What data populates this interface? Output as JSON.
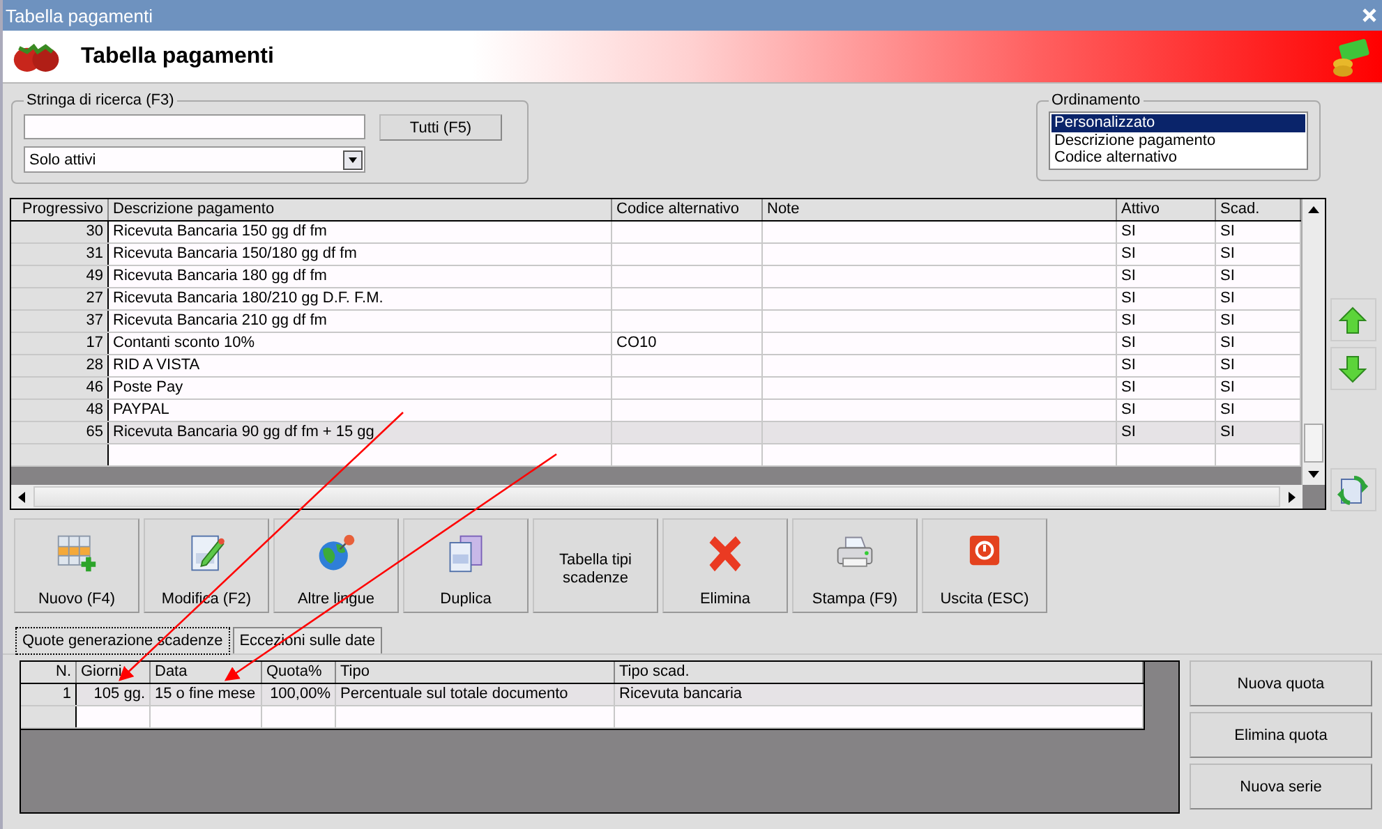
{
  "window": {
    "title": "Tabella pagamenti"
  },
  "header": {
    "title": "Tabella pagamenti"
  },
  "search": {
    "legend": "Stringa di ricerca (F3)",
    "button": "Tutti (F5)",
    "filter": "Solo attivi"
  },
  "ordering": {
    "legend": "Ordinamento",
    "items": [
      {
        "label": "Personalizzato",
        "selected": true
      },
      {
        "label": "Descrizione pagamento",
        "selected": false
      },
      {
        "label": "Codice alternativo",
        "selected": false
      }
    ]
  },
  "table": {
    "columns": [
      "Progressivo",
      "Descrizione pagamento",
      "Codice alternativo",
      "Note",
      "Attivo",
      "Scad."
    ],
    "rows": [
      {
        "cells": [
          "30",
          "Ricevuta Bancaria 150 gg df fm",
          "",
          "",
          "SI",
          "SI"
        ],
        "selected": false
      },
      {
        "cells": [
          "31",
          "Ricevuta Bancaria 150/180 gg df fm",
          "",
          "",
          "SI",
          "SI"
        ],
        "selected": false
      },
      {
        "cells": [
          "49",
          "Ricevuta Bancaria 180 gg df fm",
          "",
          "",
          "SI",
          "SI"
        ],
        "selected": false
      },
      {
        "cells": [
          "27",
          "Ricevuta Bancaria 180/210 gg D.F. F.M.",
          "",
          "",
          "SI",
          "SI"
        ],
        "selected": false
      },
      {
        "cells": [
          "37",
          "Ricevuta Bancaria 210 gg df fm",
          "",
          "",
          "SI",
          "SI"
        ],
        "selected": false
      },
      {
        "cells": [
          "17",
          "Contanti sconto 10%",
          "CO10",
          "",
          "SI",
          "SI"
        ],
        "selected": false
      },
      {
        "cells": [
          "28",
          "RID A VISTA",
          "",
          "",
          "SI",
          "SI"
        ],
        "selected": false
      },
      {
        "cells": [
          "46",
          "Poste Pay",
          "",
          "",
          "SI",
          "SI"
        ],
        "selected": false
      },
      {
        "cells": [
          "48",
          "PAYPAL",
          "",
          "",
          "SI",
          "SI"
        ],
        "selected": false
      },
      {
        "cells": [
          "65",
          "Ricevuta Bancaria 90 gg df fm + 15 gg",
          "",
          "",
          "SI",
          "SI"
        ],
        "selected": true
      }
    ]
  },
  "toolbar": [
    {
      "label": "Nuovo (F4)",
      "kind": "new"
    },
    {
      "label": "Modifica (F2)",
      "kind": "edit"
    },
    {
      "label": "Altre lingue",
      "kind": "globe"
    },
    {
      "label": "Duplica",
      "kind": "copy"
    },
    {
      "label": "Tabella tipi scadenze",
      "kind": "text"
    },
    {
      "label": "Elimina",
      "kind": "delete"
    },
    {
      "label": "Stampa (F9)",
      "kind": "print"
    },
    {
      "label": "Uscita (ESC)",
      "kind": "exit"
    }
  ],
  "tabs": [
    {
      "label": "Quote generazione scadenze",
      "selected": true
    },
    {
      "label": "Eccezioni sulle date",
      "selected": false
    }
  ],
  "quotes": {
    "columns": [
      "N.",
      "Giorni",
      "Data",
      "Quota%",
      "Tipo",
      "Tipo scad."
    ],
    "rows": [
      {
        "cells": [
          "1",
          "105 gg.",
          "15 o fine mese",
          "100,00%",
          "Percentuale sul totale documento",
          "Ricevuta bancaria"
        ],
        "selected": true
      }
    ]
  },
  "quote_buttons": [
    "Nuova quota",
    "Elimina quota",
    "Nuova serie"
  ]
}
